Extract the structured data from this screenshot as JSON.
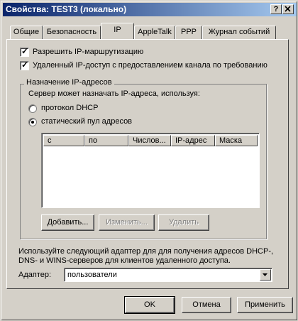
{
  "window": {
    "title": "Свойства: TEST3 (локально)",
    "help_button": "?",
    "close_button": "X"
  },
  "tabs": [
    {
      "label": "Общие"
    },
    {
      "label": "Безопасность"
    },
    {
      "label": "IP",
      "active": true
    },
    {
      "label": "AppleTalk"
    },
    {
      "label": "PPP"
    },
    {
      "label": "Журнал событий"
    }
  ],
  "options": {
    "enable_routing": {
      "label": "Разрешить IP-маршрутизацию",
      "checked": true
    },
    "remote_access": {
      "label": "Удаленный IP-доступ с предоставлением канала по требованию",
      "checked": true
    }
  },
  "ip_assignment": {
    "group_title": "Назначение IP-адресов",
    "description": "Сервер может назначать IP-адреса, используя:",
    "dhcp_label": "протокол DHCP",
    "static_label": "статический пул адресов",
    "selected": "static"
  },
  "address_table": {
    "columns": [
      "с",
      "по",
      "Числов...",
      "IP-адрес",
      "Маска"
    ],
    "rows": []
  },
  "pool_buttons": {
    "add": "Добавить...",
    "edit": "Изменить...",
    "delete": "Удалить"
  },
  "adapter": {
    "info_line1": "Используйте следующий адаптер для для получения адресов DHCP-,",
    "info_line2": "DNS- и WINS-серверов для клиентов удаленного доступа.",
    "label": "Адаптер:",
    "selected": "пользователи"
  },
  "dialog_buttons": {
    "ok": "OK",
    "cancel": "Отмена",
    "apply": "Применить"
  },
  "colors": {
    "title_start": "#0a246a",
    "title_end": "#a6caf0",
    "face": "#d4d0c8"
  }
}
